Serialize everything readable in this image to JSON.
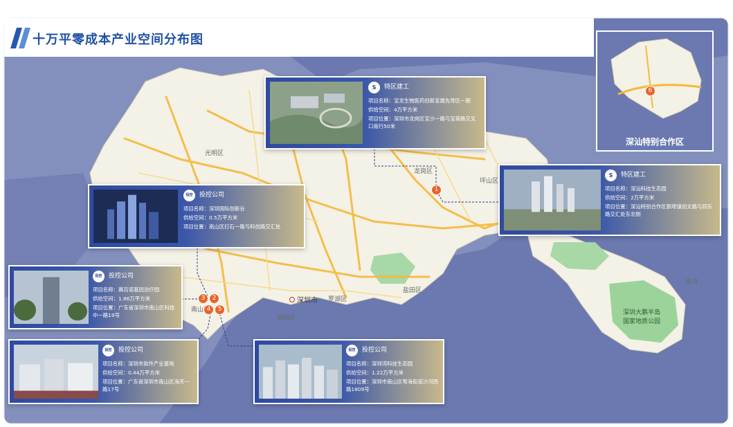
{
  "title": "十万平零成本产业空间分布图",
  "inset_label": "深汕特别合作区",
  "inset_pin": "6",
  "map_labels": {
    "guangming": "光明区",
    "shenzhen": "深圳市",
    "luohu": "罗湖区",
    "futian": "福田区",
    "yantian": "盐田区",
    "longgang": "龙岗区",
    "pingshan": "坪山区",
    "nanshan": "南山区",
    "dapeng": "深圳大鹏半岛国家地质公园",
    "dapeng_line1": "深圳大鹏半岛",
    "dapeng_line2": "国家地质公园",
    "nanwan": "南湾"
  },
  "pins": [
    "1",
    "2",
    "3",
    "4",
    "5"
  ],
  "cards": [
    {
      "company": "特区建工",
      "logo": "S",
      "name": "项目名称：宝龙生物医药创新发展先导区一期",
      "space": "供给空间：4万平方米",
      "location": "项目位置：深圳市龙岗区宝沙一路与宝荷路交叉口南行50米"
    },
    {
      "company": "特区建工",
      "logo": "S",
      "name": "项目名称：深汕科技生态园",
      "space": "供给空间：2万平方米",
      "location": "项目位置：深汕特别合作区鹅埠镇创文路与同乐路交汇处东北侧"
    },
    {
      "company": "投控公司",
      "logo": "投控",
      "name": "项目名称：深圳国际创新谷",
      "space": "供给空间：0.5万平方米",
      "location": "项目位置：南山区打石一路与科创路交汇处"
    },
    {
      "company": "投控公司",
      "logo": "投控",
      "name": "项目名称：赛百诺基因治疗园",
      "space": "供给空间：1.86万平方米",
      "location": "项目位置：广东省深圳市南山区科技中一路19号"
    },
    {
      "company": "投控公司",
      "logo": "投控",
      "name": "项目名称：深圳市软件产业基地",
      "space": "供给空间：0.44万平方米",
      "location": "项目位置：广东省深圳市南山区海天一路17号"
    },
    {
      "company": "投控公司",
      "logo": "投控",
      "name": "项目名称：深圳湾科技生态园",
      "space": "供给空间：1.22万平方米",
      "location": "项目位置：深圳市南山区粤海街道沙河西路1809号"
    }
  ],
  "colors": {
    "title": "#1f50a6",
    "pin": "#e8642a",
    "sea": "#6b79b0",
    "land": "#f4f1e6"
  }
}
